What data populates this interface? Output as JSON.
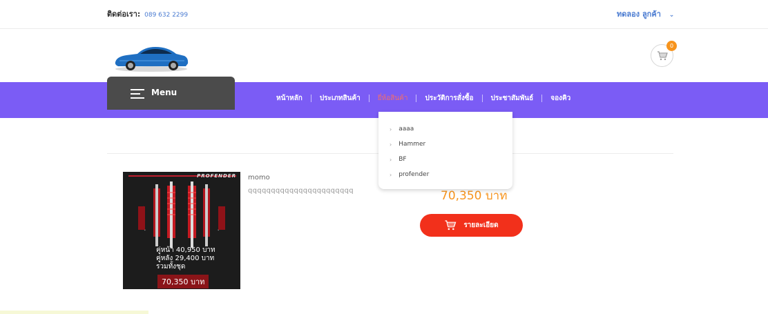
{
  "topbar": {
    "contact_label": "ติดต่อเรา:",
    "phone": "089 632 2299",
    "user_label": "ทดลอง ลูกค้า",
    "user_chevron_icon": "chevron-down-icon"
  },
  "header": {
    "logo_icon": "car-logo",
    "cart_icon": "cart-icon",
    "cart_count": "0"
  },
  "navbar": {
    "menu_label": "Menu",
    "menu_icon": "hamburger-icon",
    "links": [
      {
        "label": "หน้าหลัก"
      },
      {
        "label": "ประเภทสินค้า"
      },
      {
        "label": "ยี่ห้อสินค้า"
      },
      {
        "label": "ประวัติการสั่งซื้อ"
      },
      {
        "label": "ประชาสัมพันธ์"
      },
      {
        "label": "จองคิว"
      }
    ],
    "active_index": 2
  },
  "dropdown": {
    "items": [
      {
        "label": "aaaa"
      },
      {
        "label": "Hammer"
      },
      {
        "label": "BF"
      },
      {
        "label": "profender"
      }
    ]
  },
  "product": {
    "image": {
      "brand": "PROFENDER",
      "front_pair": "คู่หน้า 40,950 บาท",
      "rear_pair": "คู่หลัง 29,400 บาท",
      "total_label": "รวมทั้งชุด",
      "total_value": "70,350 บาท"
    },
    "name": "momo",
    "description": "qqqqqqqqqqqqqqqqqqqqqqq",
    "price": "70,350 บาท",
    "detail_button": "รายละเอียด"
  },
  "colors": {
    "navbar": "#7b5cf5",
    "menu_button": "#4b4b4b",
    "accent_price": "#f7941d",
    "detail_button": "#f2301b",
    "active_link": "#f26d6d"
  }
}
